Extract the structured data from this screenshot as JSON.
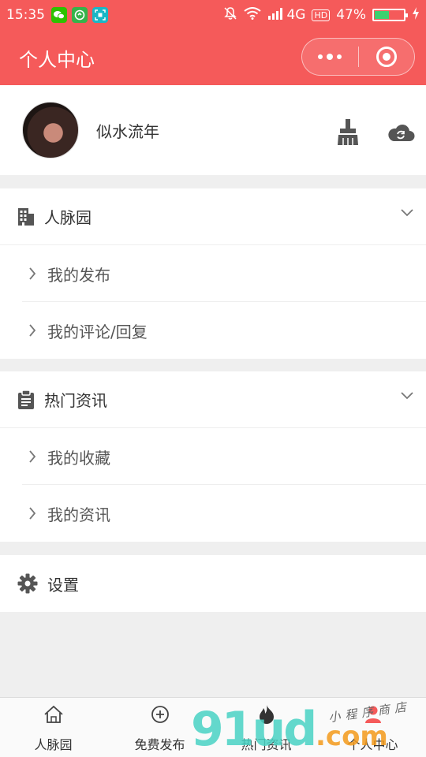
{
  "status_bar": {
    "time": "15:35",
    "network": "4G",
    "hd": "HD",
    "battery_percent": "47%",
    "battery_level": 0.47
  },
  "nav": {
    "title": "个人中心"
  },
  "profile": {
    "username": "似水流年"
  },
  "sections": [
    {
      "title": "人脉园",
      "items": [
        "我的发布",
        "我的评论/回复"
      ]
    },
    {
      "title": "热门资讯",
      "items": [
        "我的收藏",
        "我的资讯"
      ]
    }
  ],
  "settings": {
    "label": "设置"
  },
  "tabbar": {
    "tabs": [
      "人脉园",
      "免费发布",
      "热门资讯",
      "个人中心"
    ]
  },
  "watermark": {
    "main": "91ud",
    "dot_com": ".com",
    "sub": "小程序商店"
  },
  "colors": {
    "brand": "#f55a5a",
    "background": "#efefef",
    "icon_gray": "#555555"
  }
}
